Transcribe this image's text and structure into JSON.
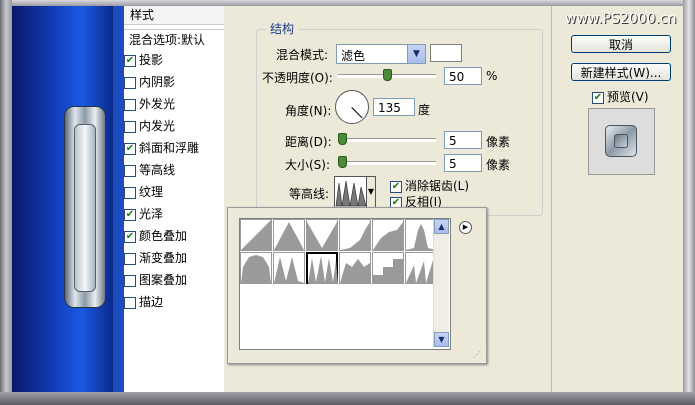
{
  "watermark": "www.PS2000.cn",
  "styles_panel": {
    "header": "样式",
    "blend_options": "混合选项:默认",
    "items": [
      {
        "label": "投影",
        "checked": true,
        "selected": false,
        "sub": false
      },
      {
        "label": "内阴影",
        "checked": false,
        "selected": false,
        "sub": false
      },
      {
        "label": "外发光",
        "checked": false,
        "selected": false,
        "sub": false
      },
      {
        "label": "内发光",
        "checked": false,
        "selected": false,
        "sub": false
      },
      {
        "label": "斜面和浮雕",
        "checked": true,
        "selected": false,
        "sub": false
      },
      {
        "label": "等高线",
        "checked": false,
        "selected": false,
        "sub": true
      },
      {
        "label": "纹理",
        "checked": false,
        "selected": false,
        "sub": true
      },
      {
        "label": "光泽",
        "checked": true,
        "selected": true,
        "sub": false
      },
      {
        "label": "颜色叠加",
        "checked": true,
        "selected": false,
        "sub": false
      },
      {
        "label": "渐变叠加",
        "checked": false,
        "selected": false,
        "sub": false
      },
      {
        "label": "图案叠加",
        "checked": false,
        "selected": false,
        "sub": false
      },
      {
        "label": "描边",
        "checked": false,
        "selected": false,
        "sub": false
      }
    ]
  },
  "structure": {
    "title": "结构",
    "blend_mode_label": "混合模式:",
    "blend_mode_value": "滤色",
    "opacity_label": "不透明度(O):",
    "opacity_value": "50",
    "opacity_unit": "%",
    "opacity_level": 0.5,
    "angle_label": "角度(N):",
    "angle_value": "135",
    "angle_unit": "度",
    "distance_label": "距离(D):",
    "distance_value": "5",
    "distance_unit": "像素",
    "size_label": "大小(S):",
    "size_value": "5",
    "size_unit": "像素",
    "contour_label": "等高线:",
    "anti_alias_label": "消除锯齿(L)",
    "anti_alias_checked": true,
    "invert_label": "反相(I)",
    "invert_checked": true
  },
  "buttons": {
    "cancel": "取消",
    "new_style": "新建样式(W)...",
    "preview_label": "预览(V)",
    "preview_checked": true
  },
  "contour_picker": {
    "shapes": [
      "linear",
      "cone",
      "cone-inverted",
      "cove-deep",
      "cove-shallow",
      "gaussian",
      "half-round",
      "ring",
      "ring-double",
      "rolling-slope",
      "rounded-steps",
      "sawtooth"
    ],
    "selected_index": 8
  },
  "colors": {
    "selection": "#316ac5",
    "check": "#1a7a1a",
    "group_title": "#1a3a8a"
  }
}
